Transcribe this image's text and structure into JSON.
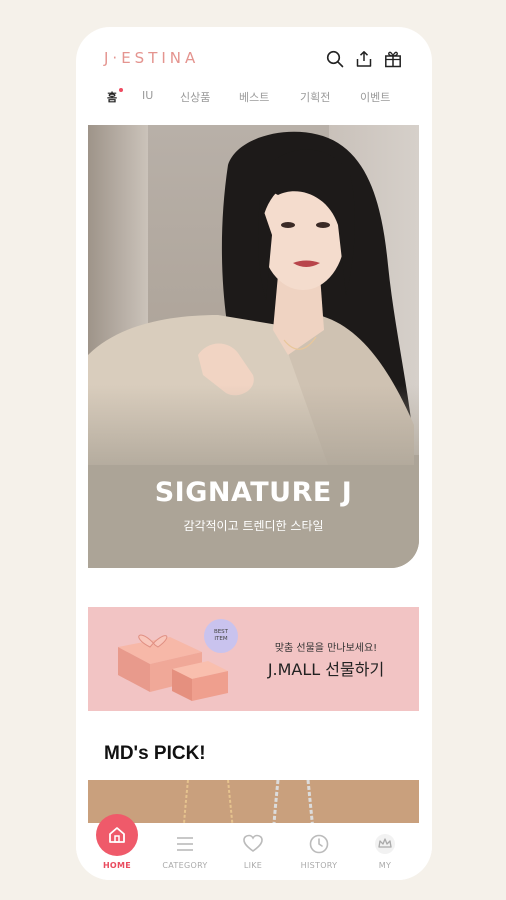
{
  "header": {
    "logo": "J·ESTINA",
    "icons": [
      "search-icon",
      "share-icon",
      "gift-icon"
    ]
  },
  "nav": {
    "items": [
      {
        "label": "홈",
        "active": true
      },
      {
        "label": "IU"
      },
      {
        "label": "신상품"
      },
      {
        "label": "베스트"
      },
      {
        "label": "기획전"
      },
      {
        "label": "이벤트"
      }
    ]
  },
  "hero": {
    "title": "SIGNATURE J",
    "subtitle": "감각적이고 트렌디한 스타일"
  },
  "banner": {
    "badge_line1": "BEST",
    "badge_line2": "ITEM",
    "subtitle": "맞춤 선물을 만나보세요!",
    "title": "J.MALL 선물하기"
  },
  "section": {
    "title": "MD's PICK!"
  },
  "tabbar": {
    "items": [
      {
        "label": "HOME",
        "icon": "home-icon",
        "active": true
      },
      {
        "label": "CATEGORY",
        "icon": "menu-icon"
      },
      {
        "label": "LIKE",
        "icon": "heart-icon"
      },
      {
        "label": "HISTORY",
        "icon": "clock-icon"
      },
      {
        "label": "MY",
        "icon": "crown-icon"
      }
    ]
  },
  "colors": {
    "brand": "#e4948f",
    "accent": "#ef5a6a",
    "banner_bg": "#f2c4c4",
    "hero_bg": "#aca497"
  }
}
